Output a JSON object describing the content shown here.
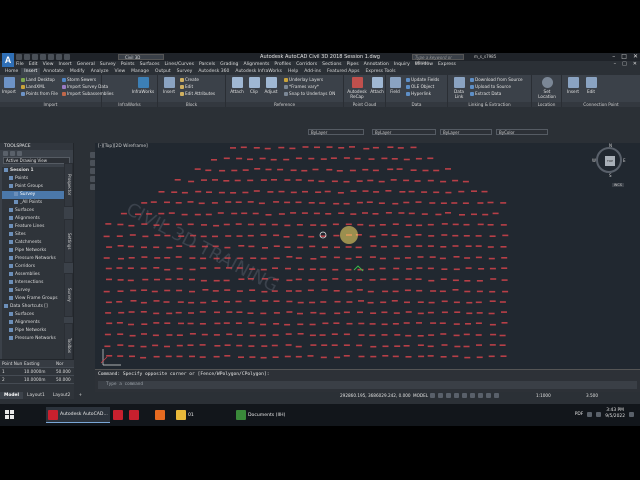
{
  "window": {
    "title": "Autodesk AutoCAD Civil 3D 2018    Session 1.dwg",
    "workspace": "Civil 3D",
    "search_placeholder": "Type a keyword or phrase",
    "user": "m_s_s7985",
    "controls": [
      "–",
      "□",
      "✕"
    ]
  },
  "menu": [
    "File",
    "Edit",
    "View",
    "Insert",
    "General",
    "Survey",
    "Points",
    "Surfaces",
    "Lines/Curves",
    "Parcels",
    "Grading",
    "Alignments",
    "Profiles",
    "Corridors",
    "Sections",
    "Pipes",
    "Annotation",
    "Inquiry",
    "Window",
    "Express"
  ],
  "tabs": [
    {
      "label": "Home",
      "active": false
    },
    {
      "label": "Insert",
      "active": true
    },
    {
      "label": "Annotate",
      "active": false
    },
    {
      "label": "Modify",
      "active": false
    },
    {
      "label": "Analyze",
      "active": false
    },
    {
      "label": "View",
      "active": false
    },
    {
      "label": "Manage",
      "active": false
    },
    {
      "label": "Output",
      "active": false
    },
    {
      "label": "Survey",
      "active": false
    },
    {
      "label": "Autodesk 360",
      "active": false
    },
    {
      "label": "Autodesk InfraWorks",
      "active": false
    },
    {
      "label": "Help",
      "active": false
    },
    {
      "label": "Add-ins",
      "active": false
    },
    {
      "label": "Featured Apps",
      "active": false
    },
    {
      "label": "Express Tools",
      "active": false
    }
  ],
  "ribbon": {
    "import": {
      "title": "Import",
      "big": "Import",
      "items": [
        "Land Desktop",
        "LandXML",
        "Points from File",
        "Storm Sewers",
        "Import Survey Data",
        "Import Subassemblies"
      ]
    },
    "infraworks": {
      "title": "InfraWorks",
      "big": "InfraWorks"
    },
    "block": {
      "title": "Block",
      "insert": "Insert",
      "items": [
        "Create",
        "Edit",
        "Edit Attributes"
      ]
    },
    "reference": {
      "title": "Reference",
      "big": [
        "Attach",
        "Clip",
        "Adjust"
      ],
      "items": [
        "Underlay Layers",
        "*Frames vary*",
        "Snap to Underlays ON"
      ]
    },
    "pointcloud": {
      "title": "Point Cloud",
      "big": [
        "Autodesk ReCap",
        "Attach"
      ]
    },
    "data": {
      "title": "Data",
      "big": [
        "Field"
      ],
      "items": [
        "Update Fields",
        "OLE Object",
        "Hyperlink"
      ]
    },
    "linking": {
      "title": "Linking & Extraction",
      "big": [
        "Data Link"
      ],
      "items": [
        "Download from Source",
        "Upload to Source",
        "Extract Data"
      ]
    },
    "location": {
      "title": "Location",
      "big": "Set Location"
    },
    "content": {
      "title": "Connection Point",
      "big": [
        "Insert",
        "Edit"
      ]
    },
    "props": {
      "layer": "ByLayer",
      "linetype": "ByLayer",
      "color": "ByLayer",
      "lineweight": "ByColor"
    }
  },
  "toolspace": {
    "title": "TOOLSPACE",
    "view": "Active Drawing View",
    "tree": [
      {
        "label": "Session 1",
        "level": 0,
        "bold": true
      },
      {
        "label": "Points",
        "level": 1
      },
      {
        "label": "Point Groups",
        "level": 1
      },
      {
        "label": "Survey",
        "level": 2,
        "selected": true
      },
      {
        "label": "_All Points",
        "level": 2
      },
      {
        "label": "Surfaces",
        "level": 1
      },
      {
        "label": "Alignments",
        "level": 1
      },
      {
        "label": "Feature Lines",
        "level": 1
      },
      {
        "label": "Sites",
        "level": 1
      },
      {
        "label": "Catchments",
        "level": 1
      },
      {
        "label": "Pipe Networks",
        "level": 1
      },
      {
        "label": "Pressure Networks",
        "level": 1
      },
      {
        "label": "Corridors",
        "level": 1
      },
      {
        "label": "Assemblies",
        "level": 1
      },
      {
        "label": "Intersections",
        "level": 1
      },
      {
        "label": "Survey",
        "level": 1
      },
      {
        "label": "View Frame Groups",
        "level": 1
      },
      {
        "label": "Data Shortcuts []",
        "level": 0
      },
      {
        "label": "Surfaces",
        "level": 1
      },
      {
        "label": "Alignments",
        "level": 1
      },
      {
        "label": "Pipe Networks",
        "level": 1
      },
      {
        "label": "Pressure Networks",
        "level": 1
      }
    ],
    "side_tabs": [
      "Prospector",
      "Settings",
      "Survey",
      "Toolbox"
    ],
    "grid_headers": [
      "Point Num...",
      "Easting",
      "Nor"
    ],
    "grid_rows": [
      [
        "1",
        "10.0000m",
        "50.000"
      ],
      [
        "2",
        "10.0000m",
        "50.000"
      ]
    ]
  },
  "drawing": {
    "viewport_label": "[-][Top][2D Wireframe]",
    "watermark": "CIVIL 3D TRAINING",
    "viewcube": {
      "top": "TOP",
      "n": "N",
      "s": "S",
      "e": "E",
      "w": "W"
    },
    "wcs": "WCS",
    "background": "#212830",
    "point_color": "#d2434b"
  },
  "command": {
    "history": "Command: Specify opposite corner or [Fence/WPolygon/CPolygon]:",
    "placeholder": "Type a command"
  },
  "layouts": [
    {
      "label": "Model",
      "active": true
    },
    {
      "label": "Layout1",
      "active": false
    },
    {
      "label": "Layout2",
      "active": false
    },
    {
      "label": "+",
      "active": false
    }
  ],
  "status": {
    "coords": "292860.195, 3686029.242, 0.000",
    "space": "MODEL",
    "scale": "1:1000",
    "units": "3.500"
  },
  "taskbar": {
    "apps": [
      {
        "label": "Autodesk AutoCAD...",
        "icon": "autocad-icon",
        "color": "#c8202e",
        "active": true
      },
      {
        "label": "",
        "icon": "autocad-icon",
        "color": "#c8202e",
        "active": false
      },
      {
        "label": "",
        "icon": "autocad-icon",
        "color": "#c8202e",
        "active": false
      },
      {
        "label": "",
        "icon": "firefox-icon",
        "color": "#e66a20",
        "active": false
      },
      {
        "label": "01",
        "icon": "folder-icon",
        "color": "#e8b83a",
        "active": false
      },
      {
        "label": "Documents (IIH)",
        "icon": "folder-icon",
        "color": "#3a8a3a",
        "active": false
      }
    ],
    "tray": {
      "lang": "PDF",
      "time": "3:43 PM",
      "date": "9/5/2022"
    }
  }
}
